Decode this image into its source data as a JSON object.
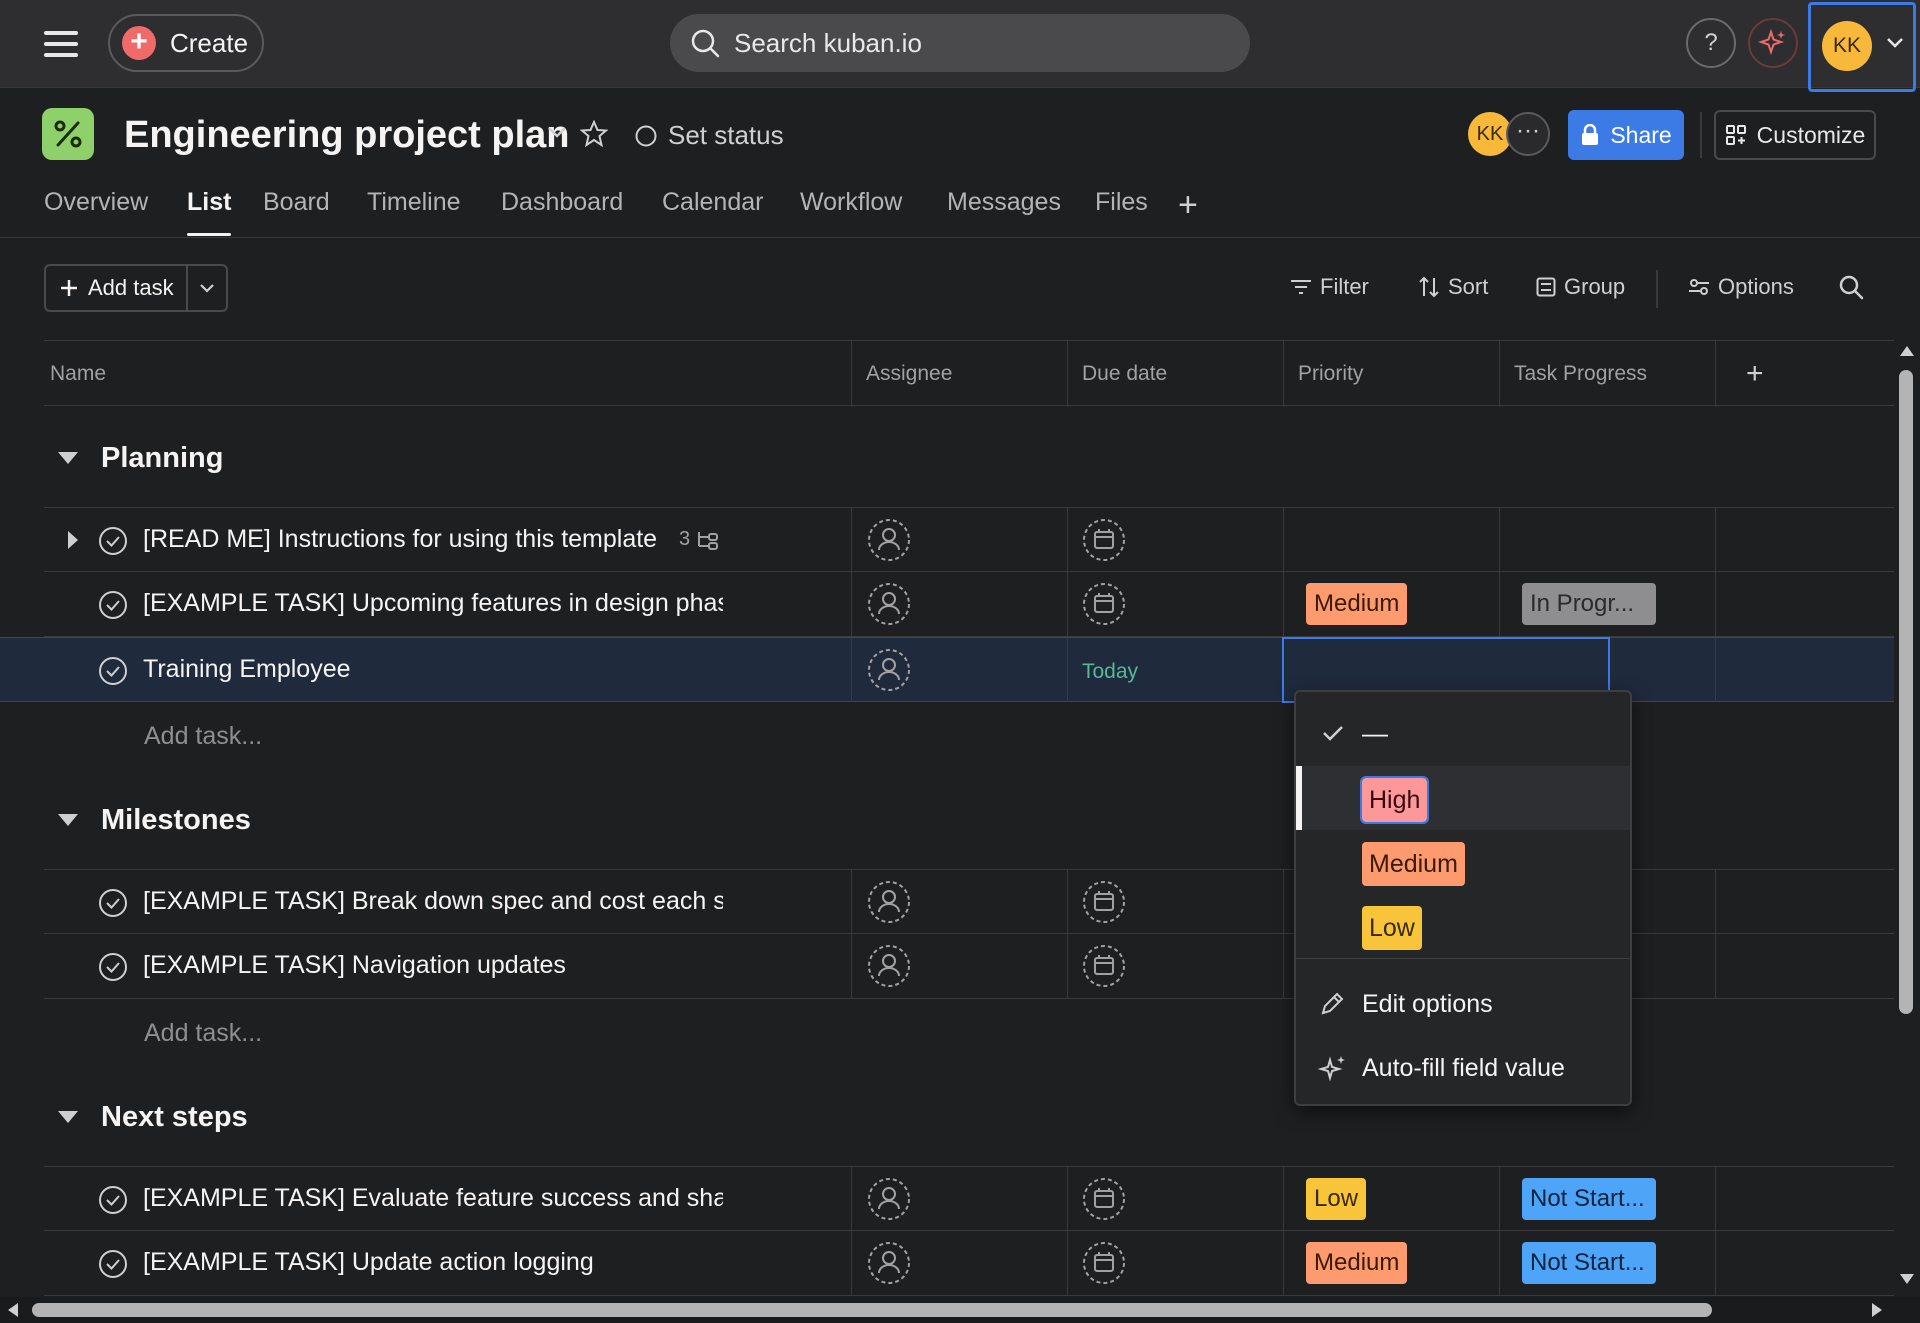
{
  "topbar": {
    "create_label": "Create",
    "search_placeholder": "Search kuban.io",
    "help_label": "?",
    "user_initials": "KK"
  },
  "project": {
    "title": "Engineering project plan",
    "set_status_label": "Set status",
    "member_initials": "KK",
    "more_label": "···",
    "share_label": "Share",
    "customize_label": "Customize",
    "icon_color": "#8ed16a"
  },
  "tabs": [
    {
      "label": "Overview",
      "active": false
    },
    {
      "label": "List",
      "active": true
    },
    {
      "label": "Board",
      "active": false
    },
    {
      "label": "Timeline",
      "active": false
    },
    {
      "label": "Dashboard",
      "active": false
    },
    {
      "label": "Calendar",
      "active": false
    },
    {
      "label": "Workflow",
      "active": false
    },
    {
      "label": "Messages",
      "active": false
    },
    {
      "label": "Files",
      "active": false
    }
  ],
  "tab_add": "+",
  "toolbar": {
    "add_task_label": "Add task",
    "filter_label": "Filter",
    "sort_label": "Sort",
    "group_label": "Group",
    "options_label": "Options"
  },
  "columns": [
    "Name",
    "Assignee",
    "Due date",
    "Priority",
    "Task Progress"
  ],
  "column_add": "+",
  "sections": [
    {
      "title": "Planning",
      "add_task_label": "Add task...",
      "tasks": [
        {
          "name": "[READ ME] Instructions for using this template",
          "subtasks": "3",
          "due": "",
          "priority": "",
          "progress": ""
        },
        {
          "name": "[EXAMPLE TASK] Upcoming features in design phas",
          "due": "",
          "priority": "Medium",
          "progress": "In Progr..."
        },
        {
          "name": "Training Employee",
          "due": "Today",
          "priority": "",
          "progress": "",
          "selected": true
        }
      ]
    },
    {
      "title": "Milestones",
      "add_task_label": "Add task...",
      "tasks": [
        {
          "name": "[EXAMPLE TASK] Break down spec and cost each stc",
          "due": "",
          "priority": "",
          "progress": ""
        },
        {
          "name": "[EXAMPLE TASK] Navigation updates",
          "due": "",
          "priority": "",
          "progress": ""
        }
      ]
    },
    {
      "title": "Next steps",
      "tasks": [
        {
          "name": "[EXAMPLE TASK] Evaluate feature success and share",
          "due": "",
          "priority": "Low",
          "progress": "Not Start..."
        },
        {
          "name": "[EXAMPLE TASK] Update action logging",
          "due": "",
          "priority": "Medium",
          "progress": "Not Start..."
        }
      ]
    }
  ],
  "priority_dropdown": {
    "none_label": "—",
    "options": [
      "High",
      "Medium",
      "Low"
    ],
    "highlighted": "High",
    "edit_label": "Edit options",
    "autofill_label": "Auto-fill field value"
  },
  "colors": {
    "accent": "#3c7be6",
    "priority_high": "#fc979a",
    "priority_medium": "#fd9a6e",
    "priority_low": "#f8c53a",
    "progress_in_progress": "#8e8e90",
    "progress_not_started": "#4ea4f6",
    "today": "#58b895"
  }
}
